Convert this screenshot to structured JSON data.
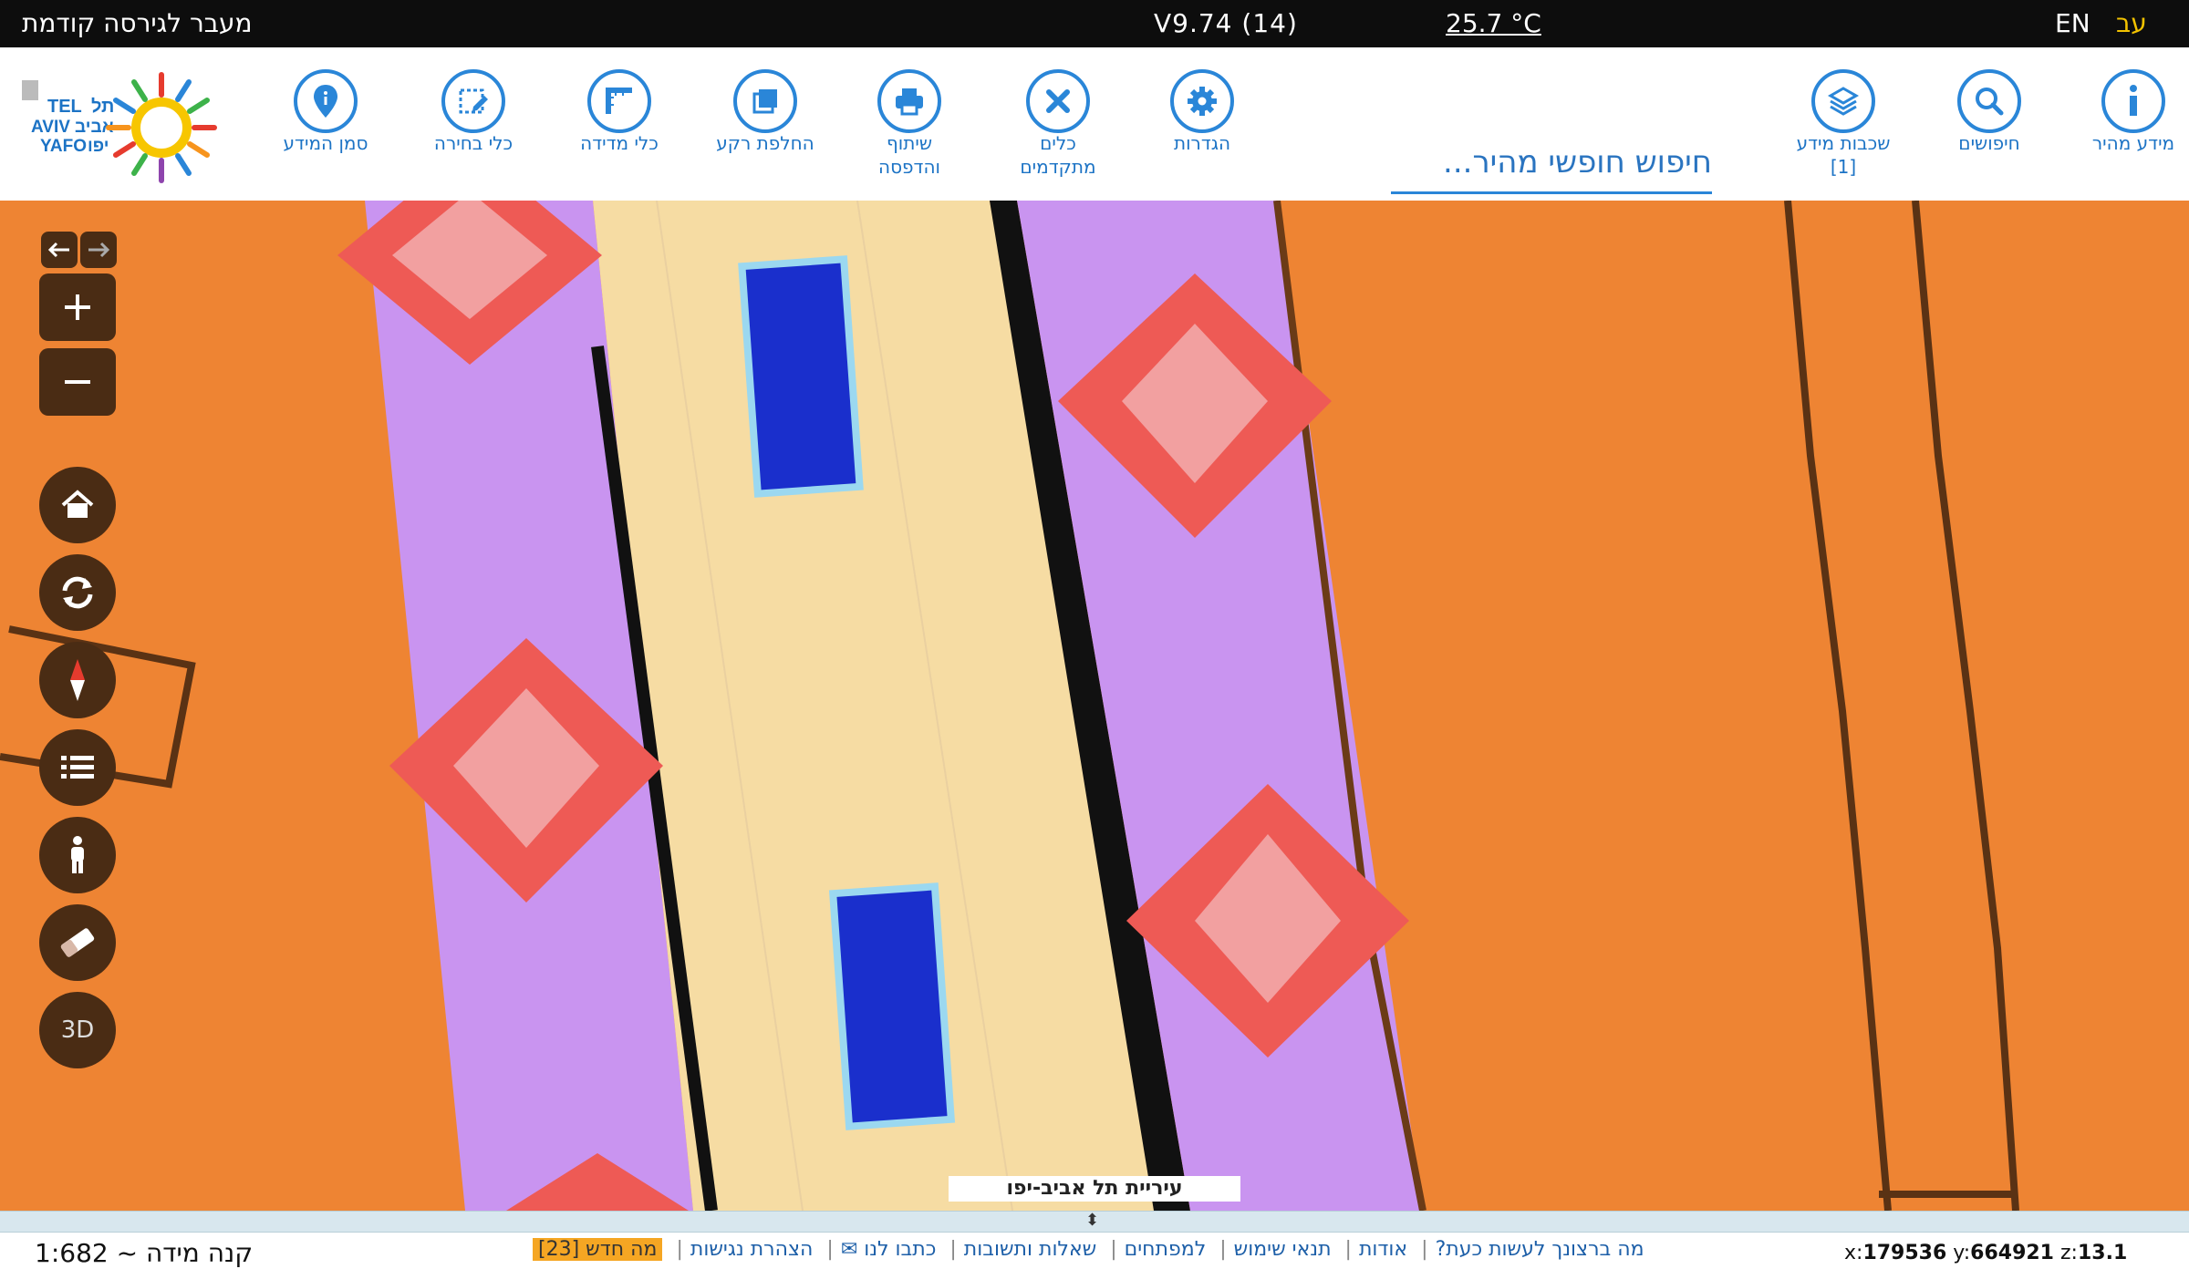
{
  "topbar": {
    "prev_version": "מעבר לגירסה קודמת",
    "version": "V9.74 (14)",
    "temperature": "25.7 °C",
    "lang_en": "EN",
    "lang_he": "עב"
  },
  "toolbar": {
    "tools": [
      {
        "label": "מידע מהיר",
        "icon": "info-icon"
      },
      {
        "label": "חיפושים",
        "icon": "search-icon"
      },
      {
        "label": "שכבות מידע\n[1]",
        "icon": "layers-icon"
      },
      {
        "label": "הגדרות",
        "icon": "gear-icon"
      },
      {
        "label": "כלים\nמתקדמים",
        "icon": "tools-icon"
      },
      {
        "label": "שיתוף\nוהדפסה",
        "icon": "print-icon"
      },
      {
        "label": "החלפת רקע",
        "icon": "basemap-icon"
      },
      {
        "label": "כלי מדידה",
        "icon": "ruler-icon"
      },
      {
        "label": "כלי בחירה",
        "icon": "select-icon"
      },
      {
        "label": "סמן המידע",
        "icon": "marker-icon"
      }
    ],
    "search_placeholder": "חיפוש חופשי מהיר..."
  },
  "logo": {
    "text_en": "TEL AVIV YAFO",
    "text_he": "תל אביב יפו"
  },
  "map_controls": {
    "three_d_label": "3D",
    "icons": [
      "arrow-left-icon",
      "arrow-right-icon",
      "zoom-in-icon",
      "zoom-out-icon",
      "home-icon",
      "refresh-icon",
      "compass-icon",
      "legend-icon",
      "street-view-icon",
      "eraser-icon"
    ]
  },
  "map": {
    "attribution": "עיריית תל אביב-יפו",
    "colors": {
      "land": "#ee8433",
      "parcel": "#c994f0",
      "road": "#f6dca3",
      "water": "#1a2fcc",
      "marker": "#ee5a55",
      "marker_center": "#f2a0a0"
    }
  },
  "bottombar": {
    "scale_label": "קנה מידה ~ 1:682",
    "links": [
      "מה ברצונך לעשות כעת?",
      "אודות",
      "תנאי שימוש",
      "למפתחים",
      "שאלות ותשובות",
      "כתבו לנו ✉",
      "הצהרת נגישות"
    ],
    "whats_new": "מה חדש [23]",
    "coords": {
      "x_label": "x:",
      "x": "179536",
      "y_label": "y:",
      "y": "664921",
      "z_label": "z:",
      "z": "13.1"
    }
  }
}
